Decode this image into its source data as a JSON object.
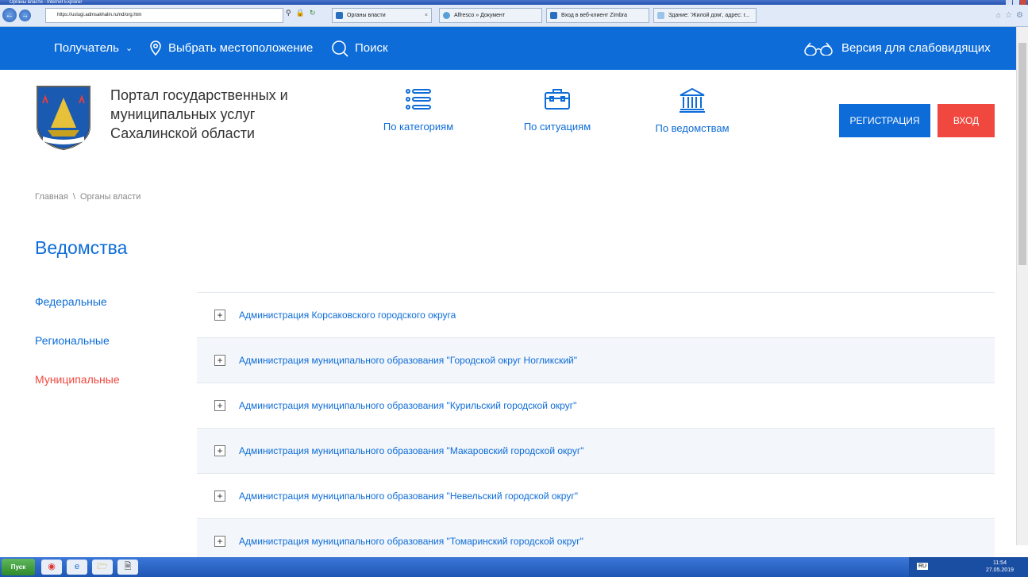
{
  "window": {
    "title": "Органы власти - Internet Explorer"
  },
  "browser": {
    "url": "https://uslugi.admsakhalin.ru/nd/org.htm",
    "tabs": [
      "Органы власти",
      "Alfresco » Документ",
      "Вход в веб-клиент Zimbra",
      "Здание: 'Жилой дом', адрес: г..."
    ]
  },
  "topnav": {
    "recipient": "Получатель",
    "location": "Выбрать местоположение",
    "search": "Поиск",
    "low_vision": "Версия для слабовидящих"
  },
  "header": {
    "portal_title": "Портал государственных и муниципальных услуг Сахалинской области",
    "nav": [
      "По категориям",
      "По ситуациям",
      "По ведомствам"
    ],
    "register": "Регистрация",
    "login": "Вход"
  },
  "breadcrumb": {
    "home": "Главная",
    "sep": "\\",
    "current": "Органы власти"
  },
  "page_title": "Ведомства",
  "sidemenu": [
    "Федеральные",
    "Региональные",
    "Муниципальные"
  ],
  "list": [
    "Администрация Корсаковского городского округа",
    "Администрация муниципального образования \"Городской округ Ногликский\"",
    "Администрация муниципального образования \"Курильский городской округ\"",
    "Администрация муниципального образования \"Макаровский городской округ\"",
    "Администрация муниципального образования \"Невельский городской округ\"",
    "Администрация муниципального образования \"Томаринский городской округ\""
  ],
  "taskbar": {
    "start": "Пуск",
    "lang": "RU",
    "time": "11:54",
    "date": "27.05.2019"
  }
}
